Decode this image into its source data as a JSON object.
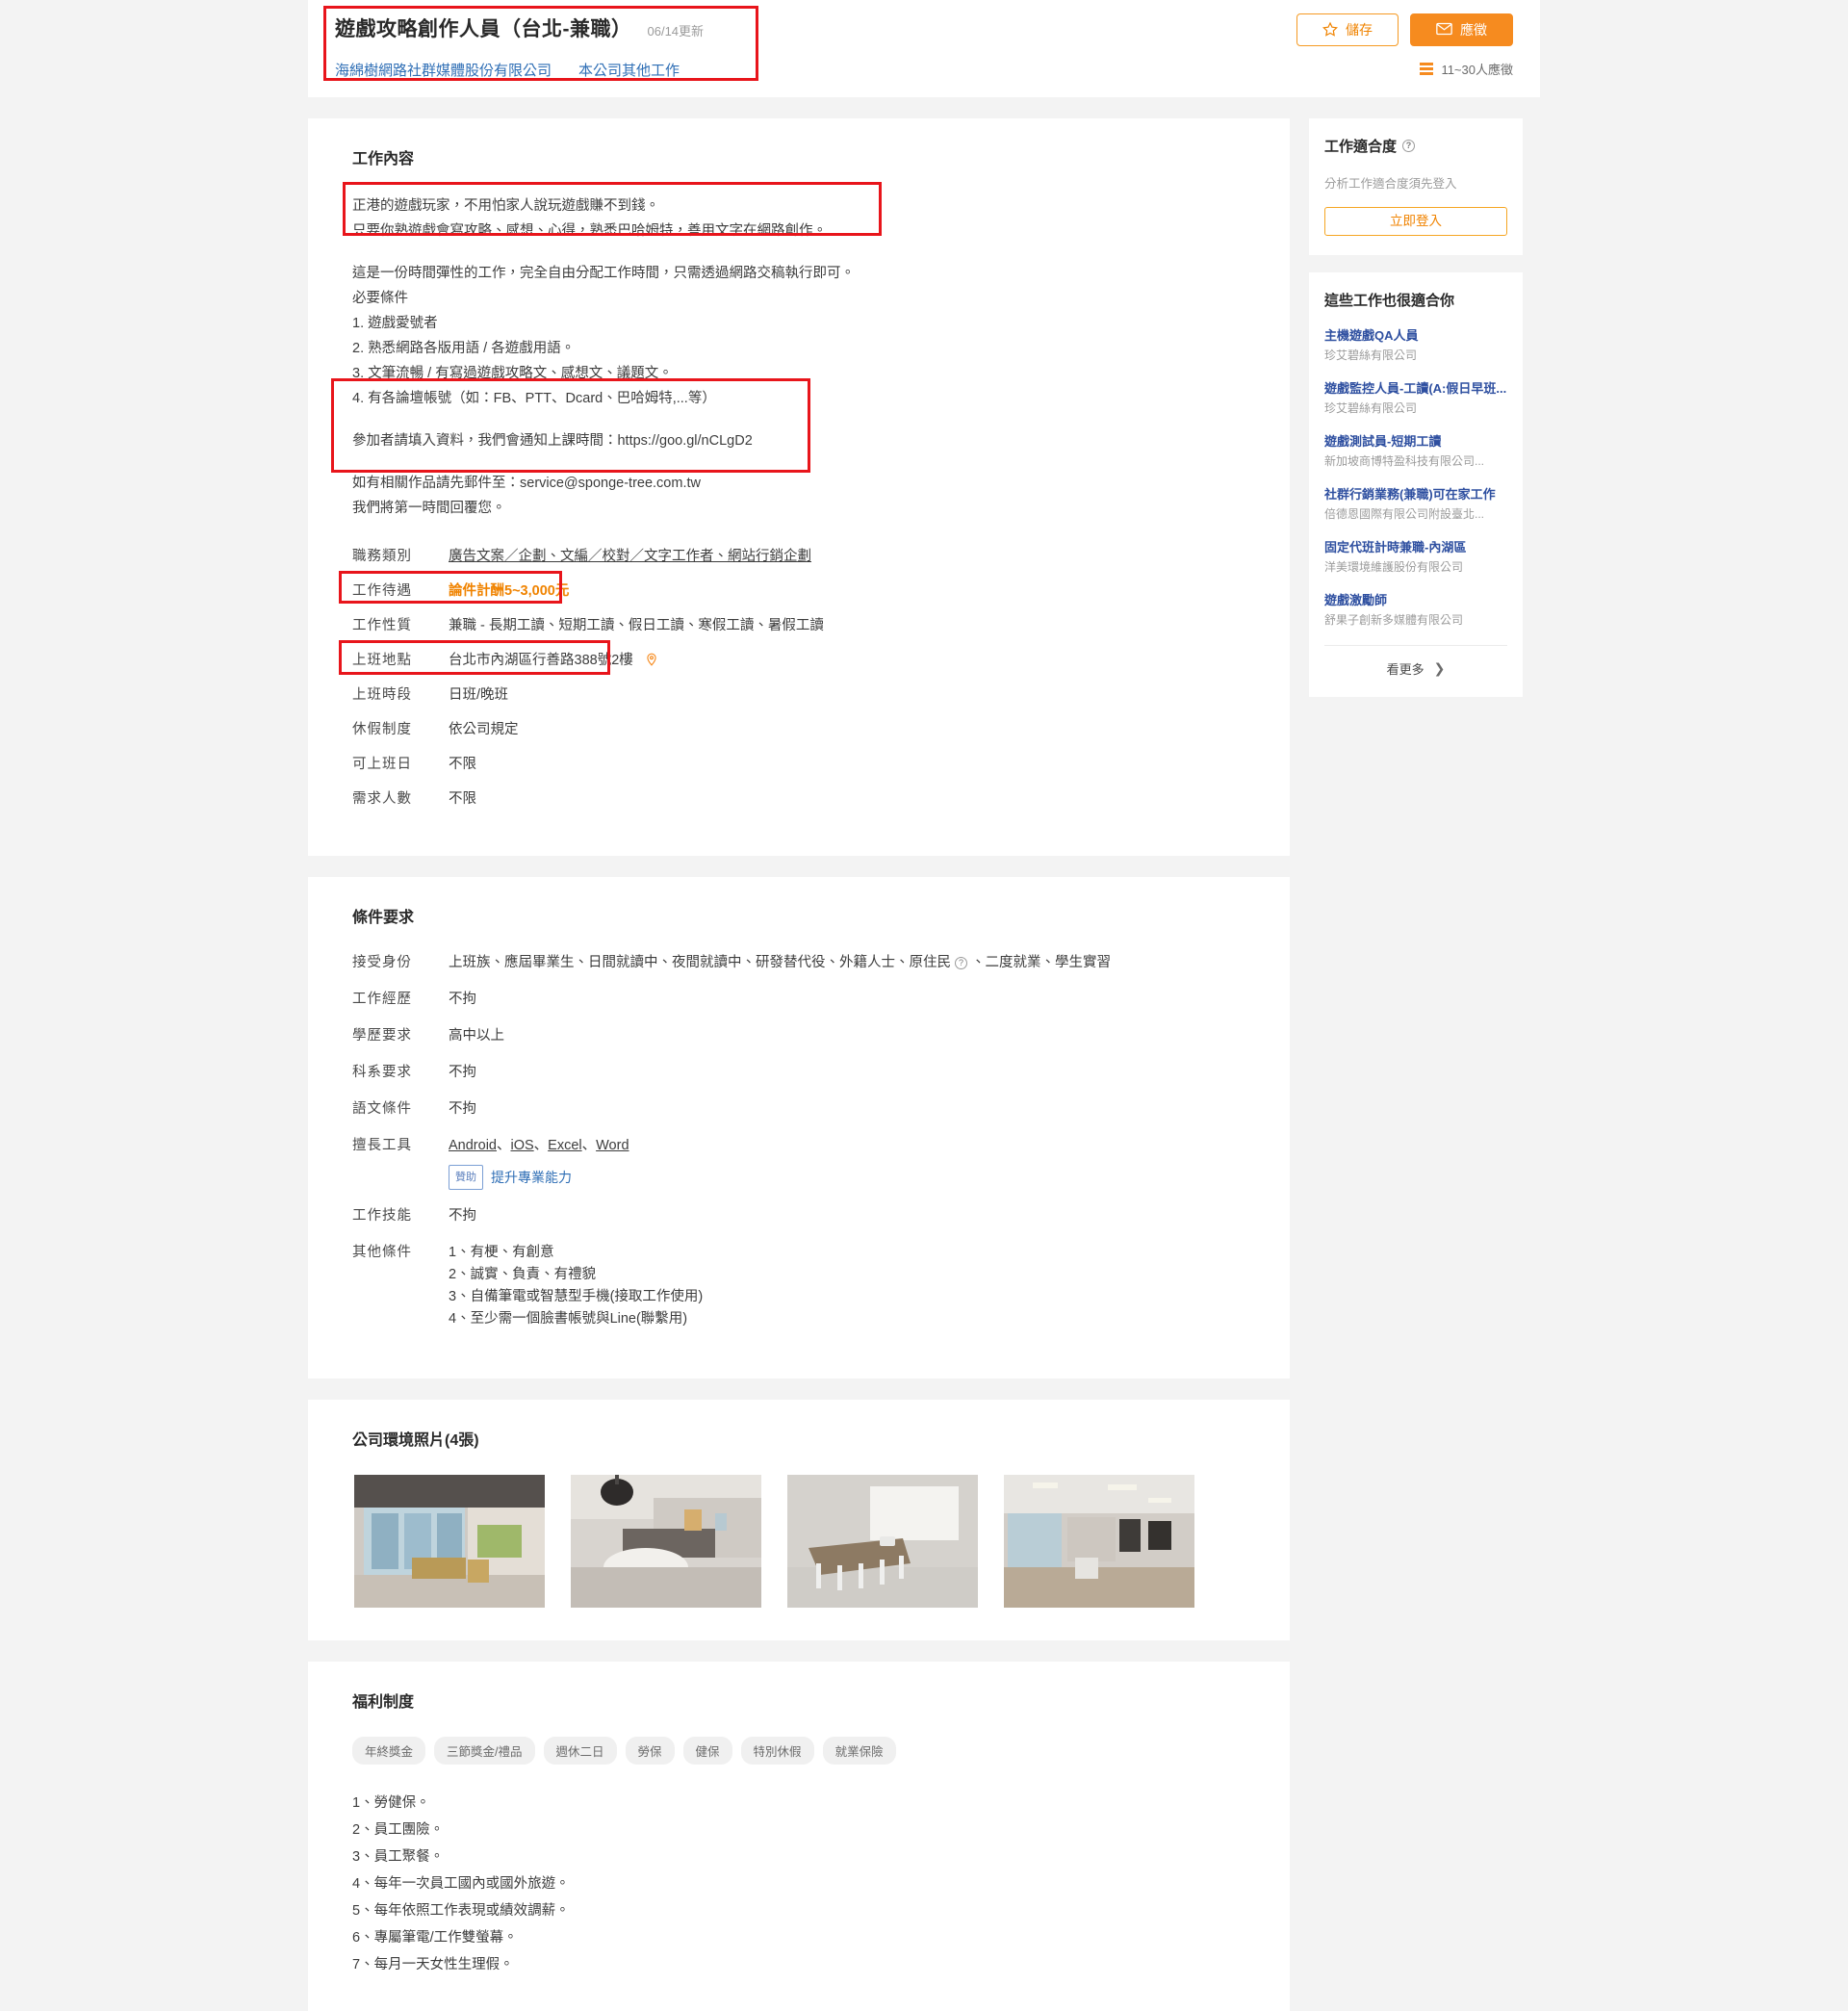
{
  "header": {
    "job_title": "遊戲攻略創作人員（台北-兼職）",
    "update_date": "06/14更新",
    "company_name": "海綿樹網路社群媒體股份有限公司",
    "company_other_jobs": "本公司其他工作",
    "save_label": "儲存",
    "apply_label": "應徵",
    "applicant_count": "11~30人應徵",
    "star_icon": "star-icon",
    "envelope_icon": "envelope-icon",
    "bars_icon": "bars-icon"
  },
  "job_content": {
    "section_title": "工作內容",
    "highlight_lines": [
      "正港的遊戲玩家，不用怕家人說玩遊戲賺不到錢。",
      "只要你熟遊戲會寫攻略、感想、心得，熟悉巴哈姆特，善用文字在網路創作。"
    ],
    "body_lines": [
      "這是一份時間彈性的工作，完全自由分配工作時間，只需透過網路交稿執行即可。",
      "必要條件",
      "1. 遊戲愛號者",
      "2. 熟悉網路各版用語 / 各遊戲用語。",
      "3. 文筆流暢 / 有寫過遊戲攻略文、感想文、議題文。",
      "4. 有各論壇帳號（如：FB、PTT、Dcard、巴哈姆特,...等）"
    ],
    "contact_lines": [
      "參加者請填入資料，我們會通知上課時間：https://goo.gl/nCLgD2",
      "",
      "如有相關作品請先郵件至：service@sponge-tree.com.tw",
      "我們將第一時間回覆您。"
    ],
    "details": [
      {
        "label": "職務類別",
        "value": "廣告文案／企劃、文編／校對／文字工作者、網站行銷企劃",
        "style": "underline"
      },
      {
        "label": "工作待遇",
        "value": "論件計酬5~3,000元",
        "style": "salary"
      },
      {
        "label": "工作性質",
        "value": "兼職 - 長期工讀、短期工讀、假日工讀、寒假工讀、暑假工讀",
        "style": "plain"
      },
      {
        "label": "上班地點",
        "value": "台北市內湖區行善路388號2樓",
        "style": "location"
      },
      {
        "label": "上班時段",
        "value": "日班/晚班",
        "style": "plain"
      },
      {
        "label": "休假制度",
        "value": "依公司規定",
        "style": "plain"
      },
      {
        "label": "可上班日",
        "value": "不限",
        "style": "plain"
      },
      {
        "label": "需求人數",
        "value": "不限",
        "style": "plain"
      }
    ]
  },
  "requirements": {
    "section_title": "條件要求",
    "rows": [
      {
        "label": "接受身份",
        "value": "上班族、應屆畢業生、日間就讀中、夜間就讀中、研發替代役、外籍人士、原住民",
        "suffix": "、二度就業、學生實習",
        "has_help": true
      },
      {
        "label": "工作經歷",
        "value": "不拘"
      },
      {
        "label": "學歷要求",
        "value": "高中以上"
      },
      {
        "label": "科系要求",
        "value": "不拘"
      },
      {
        "label": "語文條件",
        "value": "不拘"
      }
    ],
    "tools": {
      "label": "擅長工具",
      "items": [
        "Android",
        "iOS",
        "Excel",
        "Word"
      ],
      "separator": "、",
      "promo_tag": "贊助",
      "promo_text": "提升專業能力"
    },
    "skills": {
      "label": "工作技能",
      "value": "不拘"
    },
    "other": {
      "label": "其他條件",
      "lines": [
        "1、有梗、有創意",
        "2、誠實、負責、有禮貌",
        "3、自備筆電或智慧型手機(接取工作使用)",
        "4、至少需一個臉書帳號與Line(聯繫用)"
      ]
    }
  },
  "photos": {
    "section_title": "公司環境照片(4張)",
    "items": [
      {
        "alt": "open-office-with-windows"
      },
      {
        "alt": "lounge-with-pendant-lamp"
      },
      {
        "alt": "meeting-room-with-projector"
      },
      {
        "alt": "workstation-area"
      }
    ]
  },
  "benefits": {
    "section_title": "福利制度",
    "tags": [
      "年終獎金",
      "三節獎金/禮品",
      "週休二日",
      "勞保",
      "健保",
      "特別休假",
      "就業保險"
    ],
    "lines": [
      "1、勞健保。",
      "2、員工團險。",
      "3、員工聚餐。",
      "4、每年一次員工國內或國外旅遊。",
      "5、每年依照工作表現或績效調薪。",
      "6、專屬筆電/工作雙螢幕。",
      "7、每月一天女性生理假。"
    ]
  },
  "sidebar": {
    "fit": {
      "title": "工作適合度",
      "help_icon": "question-mark-icon",
      "note": "分析工作適合度須先登入",
      "login_label": "立即登入"
    },
    "recommend": {
      "title": "這些工作也很適合你",
      "items": [
        {
          "title": "主機遊戲QA人員",
          "company": "珍艾碧絲有限公司"
        },
        {
          "title": "遊戲監控人員-工讀(A:假日早班...",
          "company": "珍艾碧絲有限公司"
        },
        {
          "title": "遊戲測試員-短期工讀",
          "company": "新加坡商博特盈科技有限公司..."
        },
        {
          "title": "社群行銷業務(兼職)可在家工作",
          "company": "倍德恩國際有限公司附設臺北..."
        },
        {
          "title": "固定代班計時兼職-內湖區",
          "company": "洋美環境維護股份有限公司"
        },
        {
          "title": "遊戲激勵師",
          "company": "舒果子創新多媒體有限公司"
        }
      ],
      "more_label": "看更多",
      "more_icon": "chevron-right-icon"
    }
  },
  "colors": {
    "brand_orange": "#f68b1f",
    "link_blue": "#2e6eb5",
    "rec_blue": "#2e4fa0",
    "highlight_red": "#e8151b",
    "page_bg": "#f3f3f3"
  }
}
